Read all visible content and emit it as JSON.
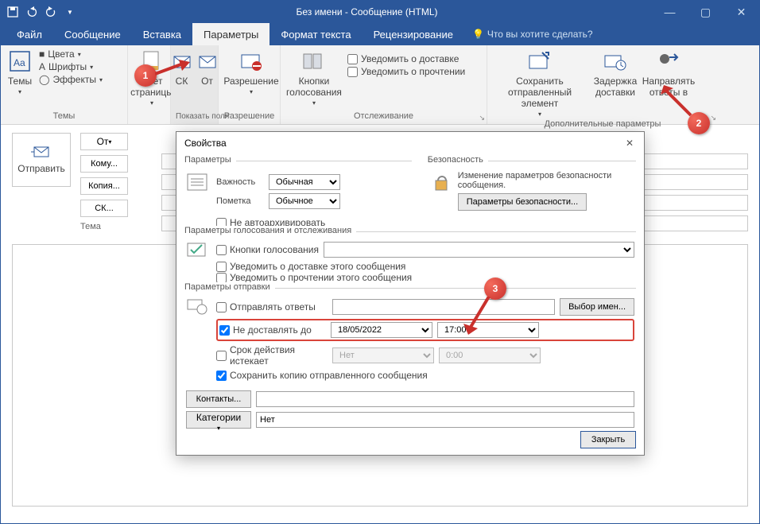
{
  "titlebar": {
    "title": "Без имени - Сообщение (HTML)"
  },
  "tabs": {
    "file": "Файл",
    "message": "Сообщение",
    "insert": "Вставка",
    "options": "Параметры",
    "format": "Формат текста",
    "review": "Рецензирование",
    "tellme": "Что вы хотите сделать?"
  },
  "ribbon": {
    "themes": {
      "label": "Темы",
      "themes_btn": "Темы",
      "colors": "Цвета",
      "fonts": "Шрифты",
      "effects": "Эффекты",
      "page_color": "Цвет\nстраницы"
    },
    "show_fields": {
      "label": "Показать поля",
      "bcc": "СК",
      "from": "От"
    },
    "permission": {
      "label": "Разрешение",
      "btn": "Разрешение"
    },
    "tracking": {
      "label": "Отслеживание",
      "voting": "Кнопки\nголосования",
      "delivery": "Уведомить о доставке",
      "read": "Уведомить о прочтении"
    },
    "more": {
      "label": "Дополнительные параметры",
      "save_sent": "Сохранить отправленный\nэлемент",
      "delay": "Задержка\nдоставки",
      "direct": "Направлять\nответы в"
    }
  },
  "compose": {
    "send": "Отправить",
    "from": "От",
    "to": "Кому...",
    "cc": "Копия...",
    "bcc": "СК...",
    "subject": "Тема"
  },
  "dialog": {
    "title": "Свойства",
    "section_params": "Параметры",
    "section_security": "Безопасность",
    "importance_lbl": "Важность",
    "importance_val": "Обычная",
    "sensitivity_lbl": "Пометка",
    "sensitivity_val": "Обычное",
    "security_text": "Изменение параметров безопасности сообщения.",
    "security_btn": "Параметры безопасности...",
    "autoarchive": "Не автоархивировать",
    "section_voting": "Параметры голосования и отслеживания",
    "voting_btns": "Кнопки голосования",
    "notify_delivery": "Уведомить о доставке этого сообщения",
    "notify_read": "Уведомить о прочтении этого сообщения",
    "section_delivery": "Параметры отправки",
    "reply_to": "Отправлять ответы",
    "select_names": "Выбор имен...",
    "delay_until": "Не доставлять до",
    "delay_date": "18/05/2022",
    "delay_time": "17:00",
    "expires": "Срок действия истекает",
    "expires_date": "Нет",
    "expires_time": "0:00",
    "save_copy": "Сохранить копию отправленного сообщения",
    "contacts": "Контакты...",
    "categories": "Категории",
    "categories_val": "Нет",
    "close": "Закрыть"
  },
  "callouts": {
    "c1": "1",
    "c2": "2",
    "c3": "3"
  }
}
